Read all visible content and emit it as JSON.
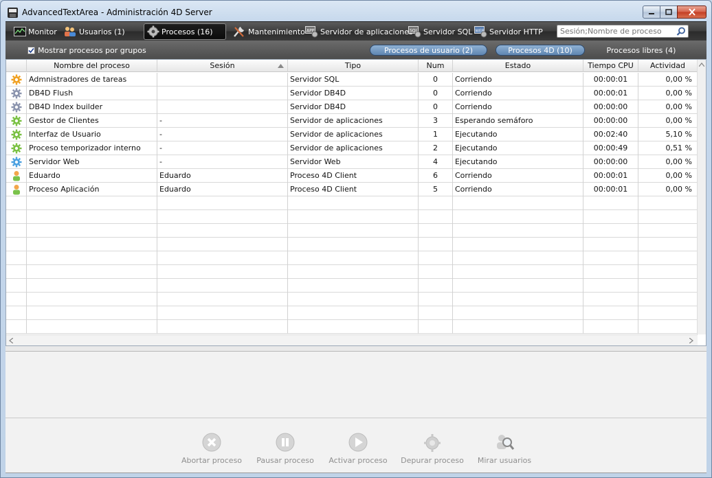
{
  "window": {
    "title": "AdvancedTextArea - Administración 4D Server"
  },
  "toolbar": {
    "tabs": [
      {
        "label": "Monitor",
        "icon": "monitor-icon"
      },
      {
        "label": "Usuarios (1)",
        "icon": "users-icon"
      },
      {
        "label": "Procesos (16)",
        "icon": "gear-icon",
        "active": true
      },
      {
        "label": "Mantenimiento",
        "icon": "tools-icon"
      },
      {
        "label": "Servidor de aplicaciones",
        "icon": "app-server-icon"
      },
      {
        "label": "Servidor SQL",
        "icon": "sql-server-icon"
      },
      {
        "label": "Servidor HTTP",
        "icon": "http-server-icon"
      }
    ],
    "search_placeholder": "Sesión;Nombre de proceso"
  },
  "filters": {
    "group_checkbox_label": "Mostrar procesos por grupos",
    "group_checkbox_checked": true,
    "user_processes": "Procesos de usuario (2)",
    "processes_4d": "Procesos 4D (10)",
    "free_processes": "Procesos libres (4)"
  },
  "table": {
    "columns": [
      "Nombre del proceso",
      "Sesión",
      "Tipo",
      "Num",
      "Estado",
      "Tiempo CPU",
      "Actividad"
    ],
    "rows": [
      {
        "icon": "orange-gear-icon",
        "name": "Admnistradores de tareas",
        "session": "",
        "type": "Servidor SQL",
        "num": "0",
        "state": "Corriendo",
        "cpu": "00:00:01",
        "activity": "0,00 %"
      },
      {
        "icon": "grey-gear-icon",
        "name": "DB4D Flush",
        "session": "",
        "type": "Servidor DB4D",
        "num": "0",
        "state": "Corriendo",
        "cpu": "00:00:01",
        "activity": "0,00 %"
      },
      {
        "icon": "grey-gear-icon",
        "name": "DB4D Index builder",
        "session": "",
        "type": "Servidor DB4D",
        "num": "0",
        "state": "Corriendo",
        "cpu": "00:00:00",
        "activity": "0,00 %"
      },
      {
        "icon": "green-gear-icon",
        "name": "Gestor de Clientes",
        "session": "-",
        "type": "Servidor de aplicaciones",
        "num": "3",
        "state": "Esperando semáforo",
        "cpu": "00:00:00",
        "activity": "0,00 %"
      },
      {
        "icon": "green-gear-icon",
        "name": "Interfaz de Usuario",
        "session": "-",
        "type": "Servidor de aplicaciones",
        "num": "1",
        "state": "Ejecutando",
        "cpu": "00:02:40",
        "activity": "5,10 %"
      },
      {
        "icon": "green-gear-icon",
        "name": "Proceso temporizador interno",
        "session": "-",
        "type": "Servidor de aplicaciones",
        "num": "2",
        "state": "Ejecutando",
        "cpu": "00:00:49",
        "activity": "0,51 %"
      },
      {
        "icon": "blue-gear-icon",
        "name": "Servidor Web",
        "session": "-",
        "type": "Servidor Web",
        "num": "4",
        "state": "Ejecutando",
        "cpu": "00:00:00",
        "activity": "0,00 %"
      },
      {
        "icon": "user-process-icon",
        "name": "Eduardo",
        "session": "Eduardo",
        "type": "Proceso 4D Client",
        "num": "6",
        "state": "Corriendo",
        "cpu": "00:00:01",
        "activity": "0,00 %"
      },
      {
        "icon": "user-process-icon",
        "name": "Proceso Aplicación",
        "session": "Eduardo",
        "type": "Proceso 4D Client",
        "num": "5",
        "state": "Corriendo",
        "cpu": "00:00:01",
        "activity": "0,00 %"
      }
    ]
  },
  "actions": [
    {
      "label": "Abortar proceso",
      "icon": "abort-icon"
    },
    {
      "label": "Pausar proceso",
      "icon": "pause-icon"
    },
    {
      "label": "Activar proceso",
      "icon": "play-icon"
    },
    {
      "label": "Depurar proceso",
      "icon": "debug-icon"
    },
    {
      "label": "Mirar usuarios",
      "icon": "watch-users-icon"
    }
  ],
  "colors": {
    "orange_gear": "#f0a020",
    "grey_gear": "#8a93ad",
    "green_gear": "#78c040",
    "blue_gear": "#4aa0e0",
    "pill_blue": "#6f93bd"
  }
}
